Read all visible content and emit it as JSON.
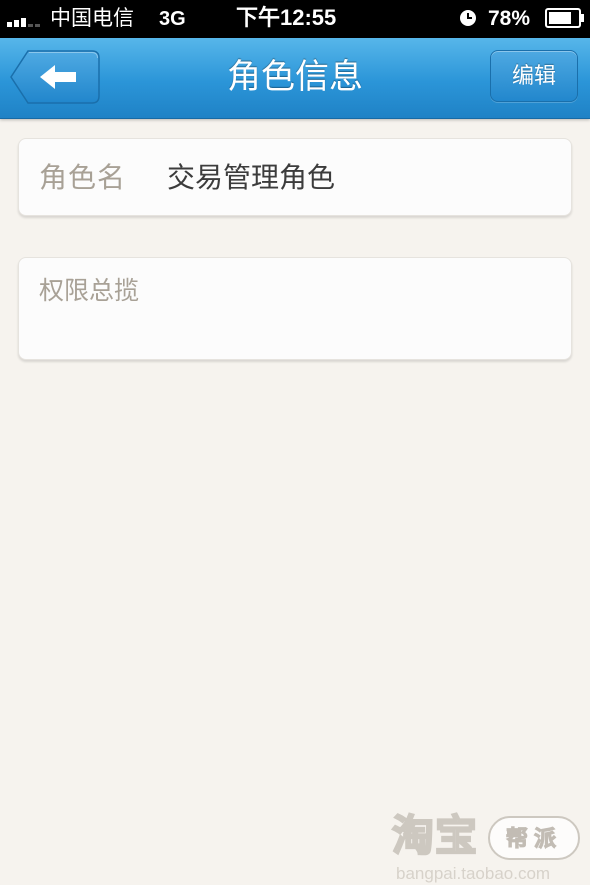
{
  "status_bar": {
    "carrier": "中国电信",
    "network": "3G",
    "time": "下午12:55",
    "battery": "78%"
  },
  "nav": {
    "title": "角色信息",
    "edit_label": "编辑",
    "back_icon": "back-arrow-icon"
  },
  "role": {
    "label": "角色名",
    "value": "交易管理角色"
  },
  "permissions": {
    "label": "权限总揽"
  },
  "watermark": {
    "brand": "淘宝",
    "bubble": "帮派",
    "url": "bangpai.taobao.com"
  },
  "colors": {
    "nav_bar": "#2b95d8",
    "background": "#f6f3ee",
    "label_text": "#a8a196",
    "value_text": "#3c3c3c"
  }
}
